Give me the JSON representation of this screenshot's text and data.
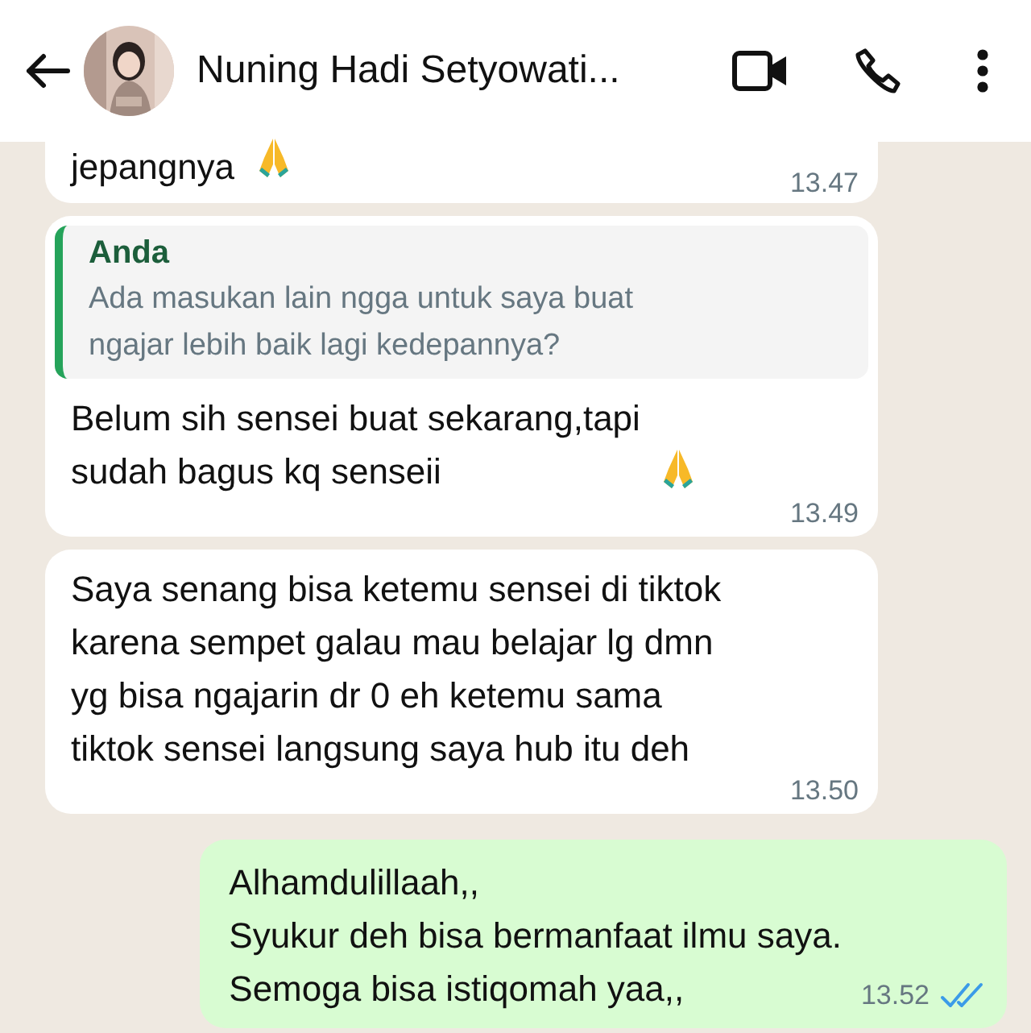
{
  "header": {
    "contact_name": "Nuning Hadi Setyowati..."
  },
  "messages": [
    {
      "kind": "incoming",
      "text": "jepangnya",
      "praying_emoji": true,
      "time": "13.47"
    },
    {
      "kind": "incoming",
      "quote": {
        "author": "Anda",
        "text": "Ada masukan lain ngga untuk saya buat\nngajar lebih baik lagi kedepannya?"
      },
      "text": "Belum sih sensei buat sekarang,tapi\nsudah bagus kq senseii",
      "praying_emoji": true,
      "time": "13.49"
    },
    {
      "kind": "incoming",
      "text": "Saya senang bisa ketemu sensei di tiktok\nkarena sempet galau mau belajar lg dmn\nyg bisa ngajarin dr 0 eh ketemu sama\ntiktok sensei langsung saya hub itu deh",
      "time": "13.50"
    },
    {
      "kind": "outgoing",
      "text": "Alhamdulillaah,,\nSyukur deh bisa bermanfaat ilmu saya.\nSemoga bisa istiqomah yaa,,",
      "time": "13.52",
      "read": true
    }
  ]
}
